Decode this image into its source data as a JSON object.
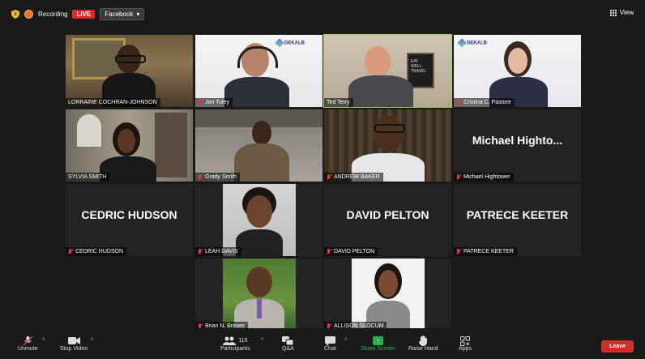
{
  "topbar": {
    "recording_label": "Recording",
    "live_label": "LIVE",
    "stream_target": "Facebook",
    "view_label": "View"
  },
  "participants": [
    {
      "name": "LORRAINE COCHRAN-JOHNSON",
      "muted": false,
      "video": true
    },
    {
      "name": "Jon Tuley",
      "muted": true,
      "video": true
    },
    {
      "name": "Ted Terry",
      "muted": false,
      "video": true,
      "speaking": true
    },
    {
      "name": "Cristina C. Pastore",
      "muted": true,
      "video": true
    },
    {
      "name": "SYLVIA SMITH",
      "muted": false,
      "video": true
    },
    {
      "name": "Grady Smith",
      "muted": true,
      "video": true
    },
    {
      "name": "ANDREW BAKER",
      "muted": true,
      "video": true
    },
    {
      "name": "Michael Hightower",
      "muted": true,
      "video": false,
      "display": "Michael  Highto..."
    },
    {
      "name": "CEDRIC HUDSON",
      "muted": true,
      "video": false,
      "display": "CEDRIC HUDSON"
    },
    {
      "name": "LEAH DAVIS",
      "muted": true,
      "video": true
    },
    {
      "name": "DAVID PELTON",
      "muted": true,
      "video": false,
      "display": "DAVID PELTON"
    },
    {
      "name": "PATRECE KEETER",
      "muted": true,
      "video": false,
      "display": "PATRECE KEETER"
    },
    {
      "name": "Brian N. Brewer",
      "muted": true,
      "video": true
    },
    {
      "name": "ALLISON SLOCUM",
      "muted": true,
      "video": true
    }
  ],
  "logo_text": "DEKALB",
  "toolbar": {
    "unmute": "Unmute",
    "stop_video": "Stop Video",
    "participants": "Participants",
    "participant_count": "115",
    "qa": "Q&A",
    "chat": "Chat",
    "share_screen": "Share Screen",
    "raise_hand": "Raise Hand",
    "apps": "Apps",
    "leave": "Leave"
  },
  "colors": {
    "background": "#1a1a1a",
    "active_speaker": "#9ed94a",
    "live": "#e02828",
    "leave": "#c8312a",
    "share": "#25b24a",
    "mute": "#e23b3b"
  }
}
